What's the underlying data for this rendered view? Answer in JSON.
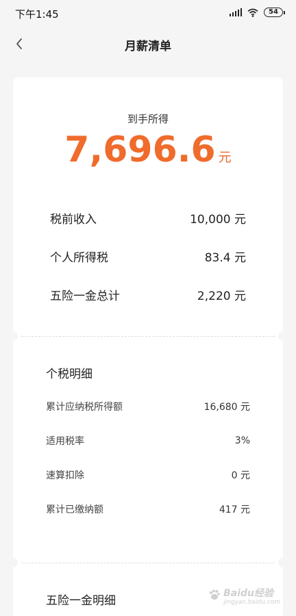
{
  "status_bar": {
    "time": "下午1:45",
    "battery": "54",
    "icons": [
      "signal-icon",
      "wifi-icon",
      "battery-icon"
    ]
  },
  "nav": {
    "title": "月薪清单",
    "back_icon": "chevron-left-icon"
  },
  "summary": {
    "take_home_label": "到手所得",
    "take_home_value": "7,696.6",
    "take_home_unit": "元",
    "rows": [
      {
        "label": "税前收入",
        "value": "10,000 元"
      },
      {
        "label": "个人所得税",
        "value": "83.4 元"
      },
      {
        "label": "五险一金总计",
        "value": "2,220 元"
      }
    ]
  },
  "tax_detail": {
    "title": "个税明细",
    "rows": [
      {
        "label": "累计应纳税所得额",
        "value": "16,680 元"
      },
      {
        "label": "适用税率",
        "value": "3%"
      },
      {
        "label": "速算扣除",
        "value": "0 元"
      },
      {
        "label": "累计已缴纳额",
        "value": "417 元"
      }
    ]
  },
  "insurance_detail": {
    "title": "五险一金明细"
  },
  "watermark": {
    "brand": "Baidu经验",
    "url": "jingyan.baidu.com"
  },
  "colors": {
    "accent": "#ef6c2c",
    "background": "#f5f5f5",
    "card": "#ffffff"
  }
}
